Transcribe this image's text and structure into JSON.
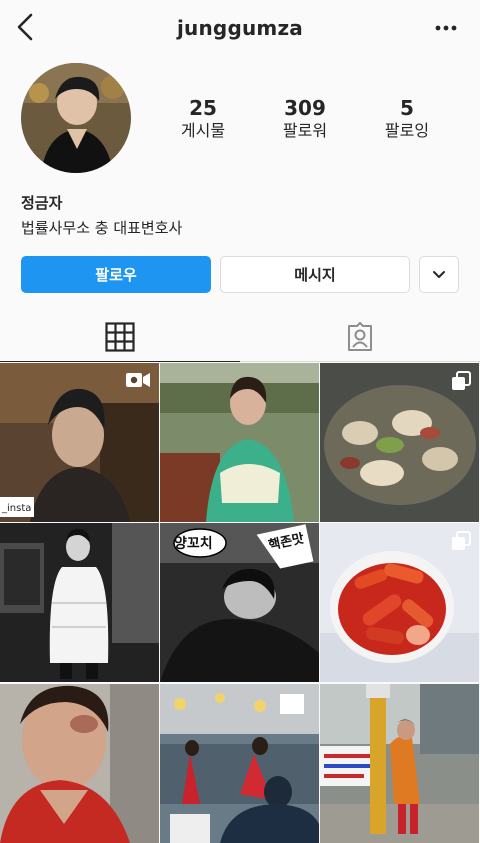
{
  "header": {
    "username": "junggumza"
  },
  "profile": {
    "stats": [
      {
        "count": "25",
        "label": "게시물"
      },
      {
        "count": "309",
        "label": "팔로워"
      },
      {
        "count": "5",
        "label": "팔로잉"
      }
    ],
    "name": "정금자",
    "bio": "법률사무소 충 대표변호사"
  },
  "actions": {
    "follow_label": "팔로우",
    "message_label": "메시지"
  },
  "posts": {
    "p1": {
      "overlay": "_insta"
    },
    "p5": {
      "caption1": "양꼬치",
      "caption2": "핵존맛"
    }
  },
  "colors": {
    "accent": "#1e95f1",
    "border": "#dbdbdb",
    "text": "#262626",
    "background": "#fafafa"
  }
}
